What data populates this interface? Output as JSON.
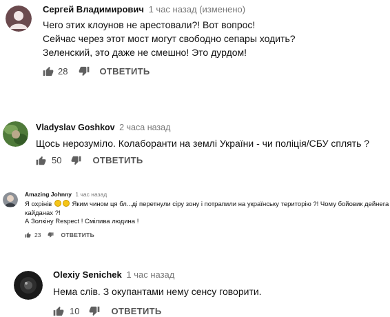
{
  "comments": [
    {
      "author": "Сергей Владимирович",
      "time": "1 час назад (изменено)",
      "lines": [
        "Чего этих клоунов не арестовали?! Вот вопрос!",
        "Сейчас через этот мост могут свободно сепары ходить?",
        "Зеленский, это даже не смешно! Это дурдом!"
      ],
      "likes": "28",
      "reply_label": "ОТВЕТИТЬ",
      "avatar_color": "#6b4a4e"
    },
    {
      "author": "Vladyslav Goshkov",
      "time": "2 часа назад",
      "lines": [
        "Щось нерозуміло. Колаборанти на землі України - чи поліція/СБУ сплять ?"
      ],
      "likes": "50",
      "reply_label": "ОТВЕТИТЬ",
      "avatar_color": "#4f7a3a"
    },
    {
      "author": "Amazing Johnny",
      "time": "1 час назад",
      "line1_a": "Я охрінів",
      "line1_b": "Яким чином ця бл...ді перетнули сіру зону і потрапили на українську територію ?! Чому бойовик дейнега не в",
      "line2": "кайданах ?!",
      "line3": "А Золкіну Respect ! Смілива людина !",
      "likes": "23",
      "reply_label": "ОТВЕТИТЬ",
      "avatar_color": "#8a8f96"
    },
    {
      "author": "Olexiy Senichek",
      "time": "1 час назад",
      "lines": [
        "Нема слів. З окупантами нему сенсу говорити."
      ],
      "likes": "10",
      "reply_label": "ОТВЕТИТЬ",
      "avatar_color": "#1a1a1a"
    }
  ],
  "icons": {
    "like": "thumbs-up-icon",
    "dislike": "thumbs-down-icon",
    "emoji": "smiley-emoji-icon"
  }
}
